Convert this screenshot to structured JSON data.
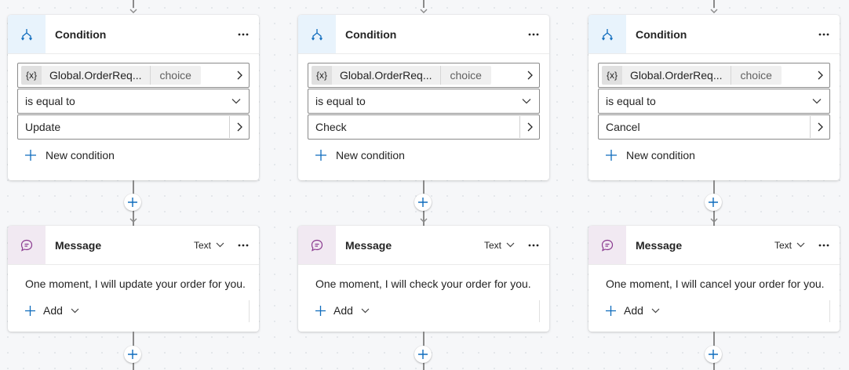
{
  "branches": [
    {
      "condition": {
        "title": "Condition",
        "var_badge": "{x}",
        "variable": "Global.OrderReq...",
        "var_type": "choice",
        "operator": "is equal to",
        "value": "Update",
        "new_condition_label": "New condition"
      },
      "message": {
        "title": "Message",
        "mode": "Text",
        "text": "One moment, I will update your order for you.",
        "add_label": "Add"
      }
    },
    {
      "condition": {
        "title": "Condition",
        "var_badge": "{x}",
        "variable": "Global.OrderReq...",
        "var_type": "choice",
        "operator": "is equal to",
        "value": "Check",
        "new_condition_label": "New condition"
      },
      "message": {
        "title": "Message",
        "mode": "Text",
        "text": "One moment, I will check your order for you.",
        "add_label": "Add"
      }
    },
    {
      "condition": {
        "title": "Condition",
        "var_badge": "{x}",
        "variable": "Global.OrderReq...",
        "var_type": "choice",
        "operator": "is equal to",
        "value": "Cancel",
        "new_condition_label": "New condition"
      },
      "message": {
        "title": "Message",
        "mode": "Text",
        "text": "One moment, I will cancel your order for you.",
        "add_label": "Add"
      }
    }
  ],
  "colors": {
    "accent": "#0f6cbd",
    "message_icon": "#8a3a8f",
    "connector": "#8a8a8a"
  },
  "icons": {
    "condition": "branch-icon",
    "message": "chat-bubble-icon",
    "more": "ellipsis-icon",
    "add": "plus-icon"
  }
}
